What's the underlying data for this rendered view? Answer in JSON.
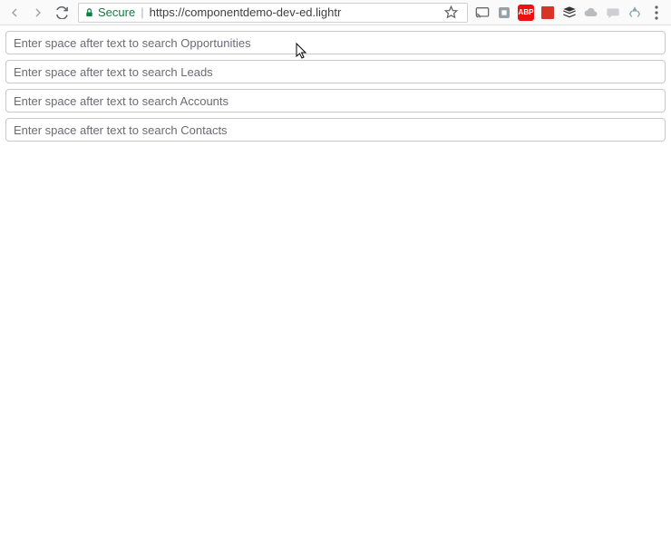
{
  "browser": {
    "secure_label": "Secure",
    "url": "https://componentdemo-dev-ed.lightr",
    "extensions": {
      "abp_label": "ABP"
    }
  },
  "inputs": [
    {
      "name": "search-opportunities-input",
      "placeholder": "Enter space after text to search Opportunities"
    },
    {
      "name": "search-leads-input",
      "placeholder": "Enter space after text to search Leads"
    },
    {
      "name": "search-accounts-input",
      "placeholder": "Enter space after text to search Accounts"
    },
    {
      "name": "search-contacts-input",
      "placeholder": "Enter space after text to search Contacts"
    }
  ]
}
